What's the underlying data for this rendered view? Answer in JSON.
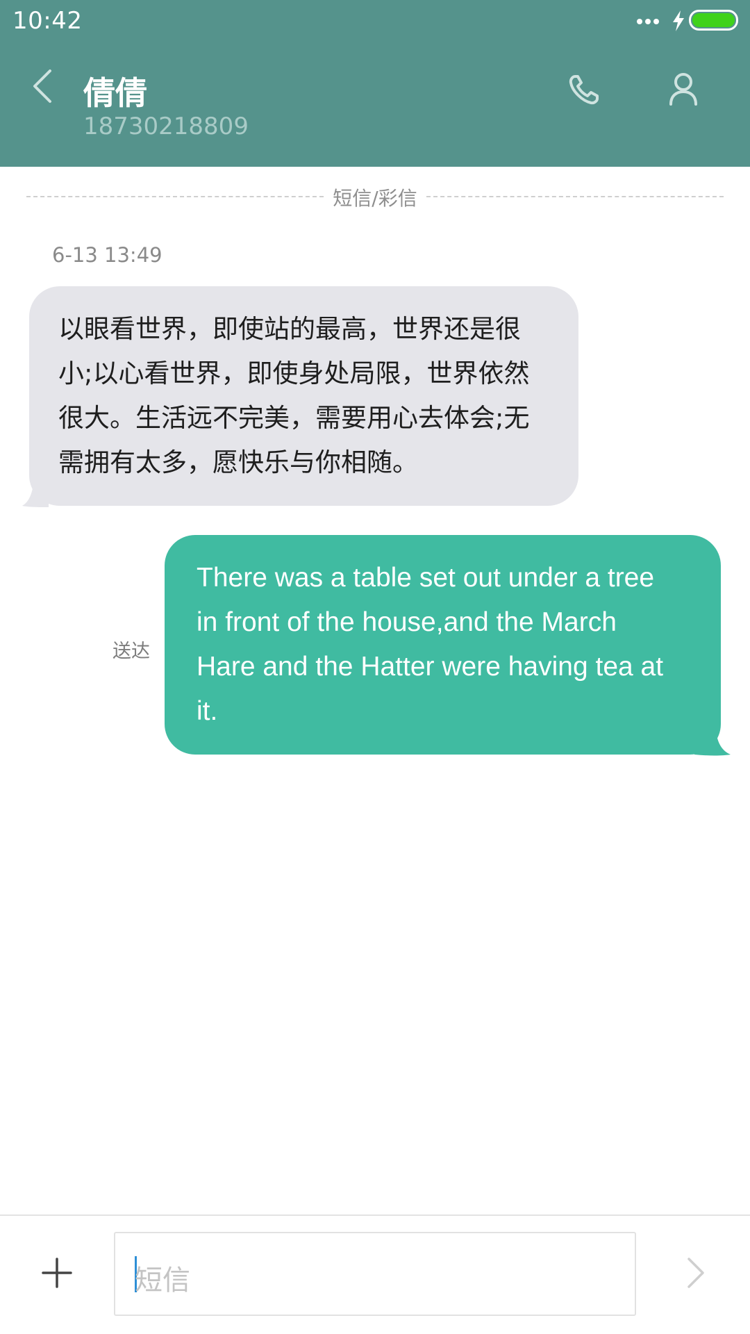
{
  "status_bar": {
    "time": "10:42",
    "icons": [
      "more-dots-icon",
      "charging-bolt-icon",
      "battery-icon"
    ],
    "battery_color": "#3fd21b"
  },
  "header": {
    "contact_name": "倩倩",
    "contact_number": "18730218809",
    "background_color": "#55938c",
    "icons": [
      "back-arrow-icon",
      "phone-icon",
      "person-icon"
    ]
  },
  "conversation": {
    "channel_label": "短信/彩信",
    "messages": [
      {
        "direction": "received",
        "timestamp": "6-13 13:49",
        "lines": [
          "以眼看世界，即使站的最高，世界还是很",
          "小;以心看世界，即使身处局限，世界依然",
          "很大。生活远不完美，需要用心去体会;无",
          "需拥有太多，愿快乐与你相随。"
        ],
        "bubble_color": "#e5e5ea"
      },
      {
        "direction": "sent",
        "status": "送达",
        "lines": [
          "There was a table set out under a tree",
          "in front of the house,and the March",
          "Hare and the Hatter were having tea at",
          "it."
        ],
        "bubble_color": "#40bba1"
      }
    ]
  },
  "compose": {
    "placeholder": "短信",
    "icons": [
      "plus-icon",
      "send-chevron-icon"
    ]
  }
}
